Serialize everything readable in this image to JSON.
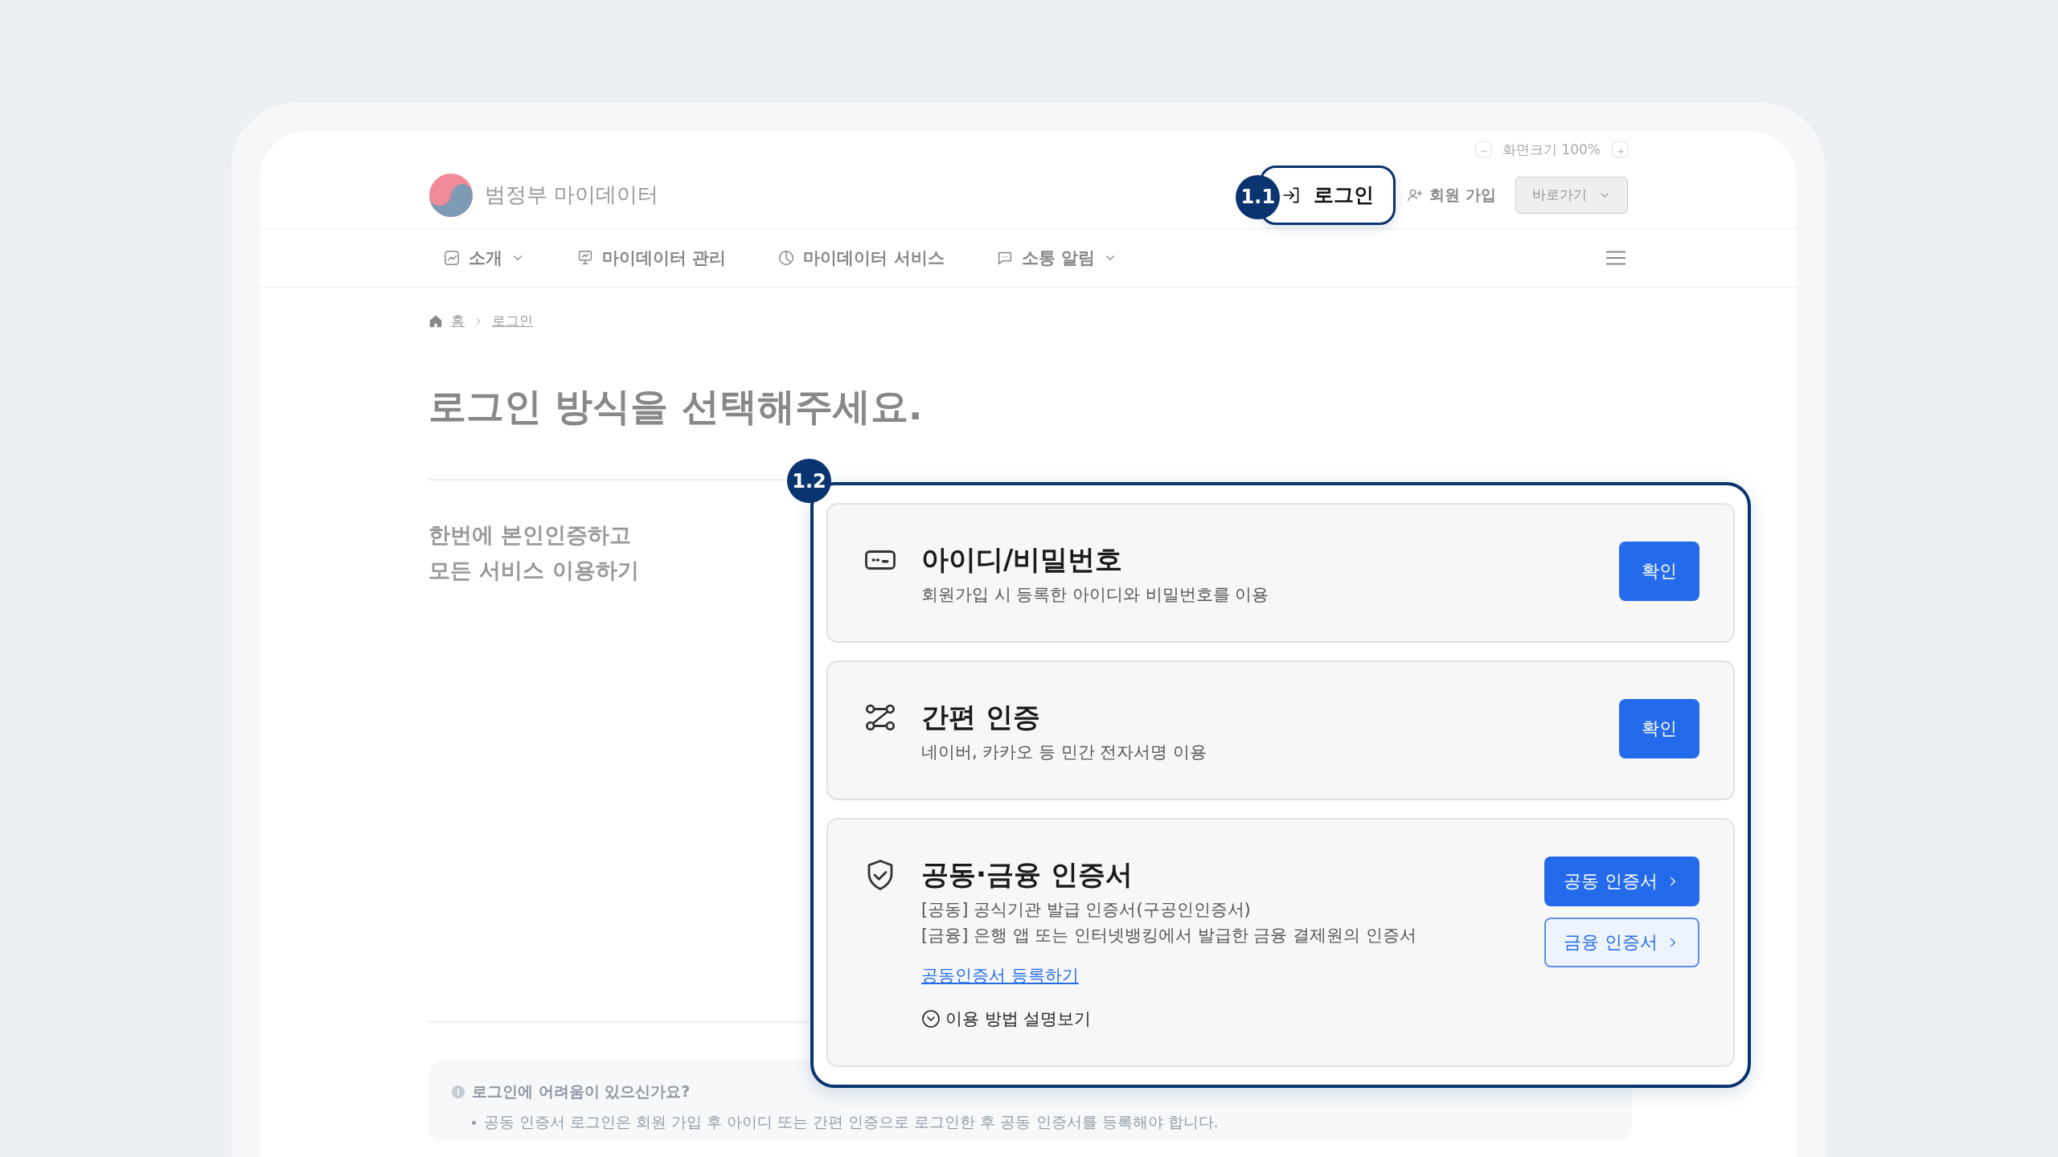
{
  "zoom_control": {
    "decrease": "−",
    "label": "화면크기 100%",
    "increase": "+"
  },
  "header": {
    "site_name": "범정부 마이데이터",
    "login": {
      "label": "로그인",
      "badge": "1.1"
    },
    "signup": "회원 가입",
    "shortcut": "바로가기"
  },
  "nav": {
    "items": [
      {
        "kind": "chart",
        "label": "소개",
        "has_menu": true
      },
      {
        "kind": "board",
        "label": "마이데이터 관리",
        "has_menu": false
      },
      {
        "kind": "pie",
        "label": "마이데이터 서비스",
        "has_menu": false
      },
      {
        "kind": "chat",
        "label": "소통 알림",
        "has_menu": true
      }
    ]
  },
  "breadcrumb": [
    "홈",
    "로그인"
  ],
  "title": "로그인 방식을 선택해주세요.",
  "intro": [
    "한번에 본인인증하고",
    "모든 서비스 이용하기"
  ],
  "methods": {
    "badge": "1.2",
    "items": [
      {
        "kind": "password",
        "title": "아이디/비밀번호",
        "description": [
          "회원가입 시 등록한 아이디와 비밀번호를 이용"
        ],
        "buttons": [
          {
            "label": "확인",
            "arrow": false
          }
        ]
      },
      {
        "kind": "simple",
        "title": "간편 인증",
        "description": [
          "네이버, 카카오 등 민간 전자서명 이용"
        ],
        "buttons": [
          {
            "label": "확인",
            "arrow": false
          }
        ]
      },
      {
        "kind": "certificate",
        "title": "공동·금융 인증서",
        "description": [
          "[공동] 공식기관 발급 인증서(구공인인증서)",
          "[금융] 은행 앱 또는 인터넷뱅킹에서 발급한 금융 결제원의 인증서"
        ],
        "link": "공동인증서 등록하기",
        "toggle": {
          "label": "이용 방법 설명보기",
          "expanded": false
        },
        "buttons": [
          {
            "label": "공동 인증서",
            "arrow": true
          },
          {
            "label": "금융 인증서",
            "arrow": true
          }
        ]
      }
    ]
  },
  "help": {
    "title": "로그인에 어려움이 있으신가요?",
    "items": [
      "공동 인증서 로그인은 회원 가입 후 아이디 또는 간편 인증으로 로그인한 후 공동 인증서를 등록해야 합니다."
    ]
  }
}
